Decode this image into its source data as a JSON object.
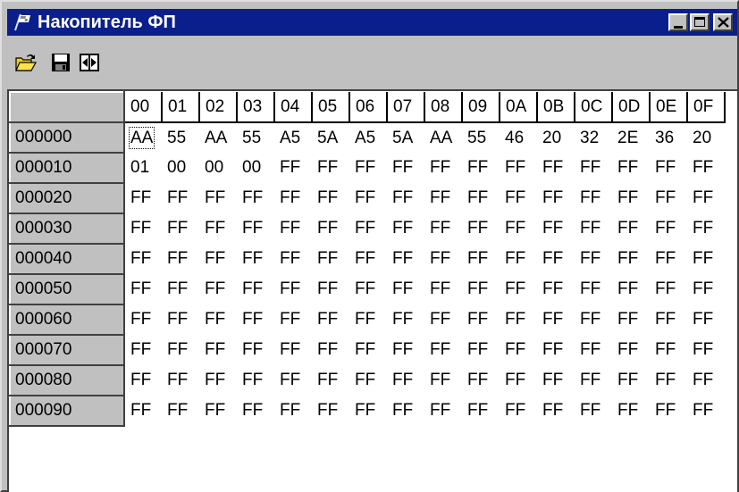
{
  "window": {
    "title": "Накопитель ФП",
    "icon": "flag-icon",
    "controls": [
      "minimize-icon",
      "maximize-icon",
      "close-icon"
    ]
  },
  "toolbar": {
    "buttons": [
      {
        "icon": "open-folder-icon"
      },
      {
        "icon": "save-disk-icon"
      },
      {
        "icon": "goto-icon"
      }
    ]
  },
  "grid": {
    "column_headers": [
      "00",
      "01",
      "02",
      "03",
      "04",
      "05",
      "06",
      "07",
      "08",
      "09",
      "0A",
      "0B",
      "0C",
      "0D",
      "0E",
      "0F"
    ],
    "rows": [
      {
        "address": "000000",
        "bytes": [
          "AA",
          "55",
          "AA",
          "55",
          "A5",
          "5A",
          "A5",
          "5A",
          "AA",
          "55",
          "46",
          "20",
          "32",
          "2E",
          "36",
          "20"
        ]
      },
      {
        "address": "000010",
        "bytes": [
          "01",
          "00",
          "00",
          "00",
          "FF",
          "FF",
          "FF",
          "FF",
          "FF",
          "FF",
          "FF",
          "FF",
          "FF",
          "FF",
          "FF",
          "FF"
        ]
      },
      {
        "address": "000020",
        "bytes": [
          "FF",
          "FF",
          "FF",
          "FF",
          "FF",
          "FF",
          "FF",
          "FF",
          "FF",
          "FF",
          "FF",
          "FF",
          "FF",
          "FF",
          "FF",
          "FF"
        ]
      },
      {
        "address": "000030",
        "bytes": [
          "FF",
          "FF",
          "FF",
          "FF",
          "FF",
          "FF",
          "FF",
          "FF",
          "FF",
          "FF",
          "FF",
          "FF",
          "FF",
          "FF",
          "FF",
          "FF"
        ]
      },
      {
        "address": "000040",
        "bytes": [
          "FF",
          "FF",
          "FF",
          "FF",
          "FF",
          "FF",
          "FF",
          "FF",
          "FF",
          "FF",
          "FF",
          "FF",
          "FF",
          "FF",
          "FF",
          "FF"
        ]
      },
      {
        "address": "000050",
        "bytes": [
          "FF",
          "FF",
          "FF",
          "FF",
          "FF",
          "FF",
          "FF",
          "FF",
          "FF",
          "FF",
          "FF",
          "FF",
          "FF",
          "FF",
          "FF",
          "FF"
        ]
      },
      {
        "address": "000060",
        "bytes": [
          "FF",
          "FF",
          "FF",
          "FF",
          "FF",
          "FF",
          "FF",
          "FF",
          "FF",
          "FF",
          "FF",
          "FF",
          "FF",
          "FF",
          "FF",
          "FF"
        ]
      },
      {
        "address": "000070",
        "bytes": [
          "FF",
          "FF",
          "FF",
          "FF",
          "FF",
          "FF",
          "FF",
          "FF",
          "FF",
          "FF",
          "FF",
          "FF",
          "FF",
          "FF",
          "FF",
          "FF"
        ]
      },
      {
        "address": "000080",
        "bytes": [
          "FF",
          "FF",
          "FF",
          "FF",
          "FF",
          "FF",
          "FF",
          "FF",
          "FF",
          "FF",
          "FF",
          "FF",
          "FF",
          "FF",
          "FF",
          "FF"
        ]
      },
      {
        "address": "000090",
        "bytes": [
          "FF",
          "FF",
          "FF",
          "FF",
          "FF",
          "FF",
          "FF",
          "FF",
          "FF",
          "FF",
          "FF",
          "FF",
          "FF",
          "FF",
          "FF",
          "FF"
        ]
      }
    ],
    "selected_cell": {
      "row": 0,
      "col": 0
    }
  },
  "colors": {
    "titlebar": "#0a1f8c",
    "face": "#c0c0c0",
    "cell_bg": "#ffffff"
  }
}
